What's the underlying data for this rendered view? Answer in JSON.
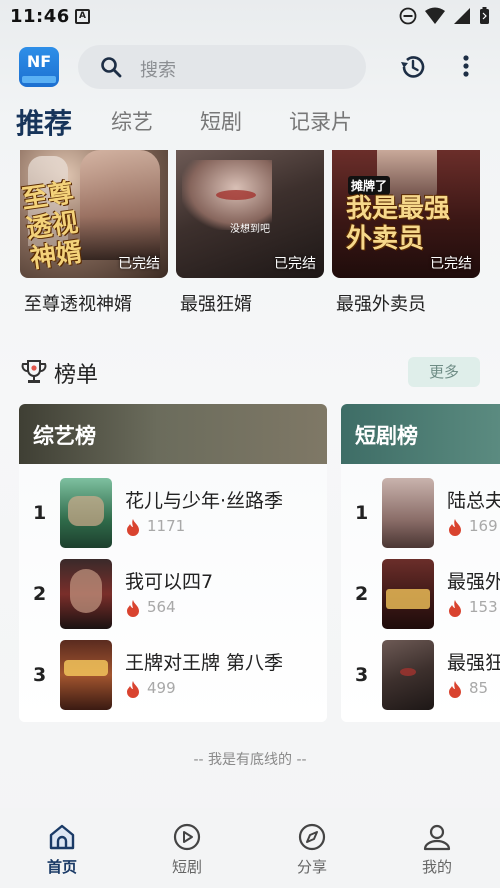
{
  "status_bar": {
    "time": "11:46",
    "notification_letter": "A"
  },
  "header": {
    "logo_text": "NF",
    "search": {
      "placeholder": "搜索"
    },
    "history_icon": "history-icon",
    "more_icon": "more-vertical-icon"
  },
  "tabs": [
    {
      "label": "推荐",
      "active": true
    },
    {
      "label": "综艺",
      "active": false
    },
    {
      "label": "短剧",
      "active": false
    },
    {
      "label": "记录片",
      "active": false
    }
  ],
  "recommended": [
    {
      "title": "至尊透视神婿",
      "badge": "已完结",
      "poster_text": "至尊透视神婿"
    },
    {
      "title": "最强狂婿",
      "badge": "已完结",
      "poster_text": "没想到吧"
    },
    {
      "title": "最强外卖员",
      "badge": "已完结",
      "poster_text": "我是最强外卖员",
      "poster_tag": "摊牌了"
    }
  ],
  "rankings": {
    "title": "榜单",
    "more_label": "更多",
    "panels": [
      {
        "title": "综艺榜",
        "items": [
          {
            "rank": "1",
            "name": "花儿与少年·丝路季",
            "hot": "1171"
          },
          {
            "rank": "2",
            "name": "我可以四7",
            "hot": "564"
          },
          {
            "rank": "3",
            "name": "王牌对王牌 第八季",
            "hot": "499"
          }
        ]
      },
      {
        "title": "短剧榜",
        "items": [
          {
            "rank": "1",
            "name": "陆总夫",
            "hot": "169"
          },
          {
            "rank": "2",
            "name": "最强外",
            "hot": "153"
          },
          {
            "rank": "3",
            "name": "最强狂",
            "hot": "85"
          }
        ]
      }
    ]
  },
  "footer_note": "-- 我是有底线的 --",
  "bottom_nav": [
    {
      "label": "首页",
      "icon": "home-icon",
      "active": true
    },
    {
      "label": "短剧",
      "icon": "play-circle-icon",
      "active": false
    },
    {
      "label": "分享",
      "icon": "compass-icon",
      "active": false
    },
    {
      "label": "我的",
      "icon": "user-icon",
      "active": false
    }
  ],
  "colors": {
    "active_tab": "#17345a",
    "fire": "#d9432f",
    "more_pill_bg": "#dfeeea",
    "panel_head_variety": "#5a5d4e",
    "panel_head_drama": "#4c8076"
  }
}
